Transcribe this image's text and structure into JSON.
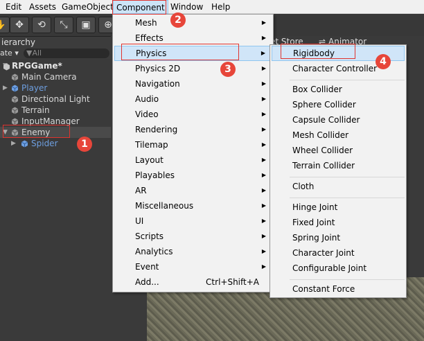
{
  "menubar": {
    "items": [
      "Edit",
      "Assets",
      "GameObject",
      "Component",
      "Window",
      "Help"
    ]
  },
  "toolbar": {
    "buttons": [
      "hand-icon",
      "move-icon",
      "rotate-icon",
      "scale-icon",
      "rect-icon",
      "transform-icon"
    ]
  },
  "hierarchy": {
    "tab_label": "ierarchy",
    "create_label": "ate ▾",
    "search_placeholder": "▼All",
    "scene_name": "RPGGame*",
    "items": [
      {
        "label": "Main Camera",
        "color": "#d8d8d8"
      },
      {
        "label": "Player",
        "color": "#6e9fe0"
      },
      {
        "label": "Directional Light",
        "color": "#d8d8d8"
      },
      {
        "label": "Terrain",
        "color": "#d8d8d8"
      },
      {
        "label": "InputManager",
        "color": "#d8d8d8"
      },
      {
        "label": "Enemy",
        "color": "#d8d8d8"
      },
      {
        "label": "Spider",
        "color": "#6e9fe0"
      }
    ]
  },
  "scene_tabs": {
    "asset_store": "et Store",
    "animator": "Animator"
  },
  "component_menu": {
    "items": [
      {
        "label": "Mesh",
        "submenu": true
      },
      {
        "label": "Effects",
        "submenu": true
      },
      {
        "label": "Physics",
        "submenu": true
      },
      {
        "label": "Physics 2D",
        "submenu": true
      },
      {
        "label": "Navigation",
        "submenu": true
      },
      {
        "label": "Audio",
        "submenu": true
      },
      {
        "label": "Video",
        "submenu": true
      },
      {
        "label": "Rendering",
        "submenu": true
      },
      {
        "label": "Tilemap",
        "submenu": true
      },
      {
        "label": "Layout",
        "submenu": true
      },
      {
        "label": "Playables",
        "submenu": true
      },
      {
        "label": "AR",
        "submenu": true
      },
      {
        "label": "Miscellaneous",
        "submenu": true
      },
      {
        "label": "UI",
        "submenu": true
      },
      {
        "label": "Scripts",
        "submenu": true
      },
      {
        "label": "Analytics",
        "submenu": true
      },
      {
        "label": "Event",
        "submenu": true
      },
      {
        "label": "Add...",
        "submenu": false,
        "shortcut": "Ctrl+Shift+A"
      }
    ]
  },
  "physics_menu": {
    "groups": [
      [
        "Rigidbody",
        "Character Controller"
      ],
      [
        "Box Collider",
        "Sphere Collider",
        "Capsule Collider",
        "Mesh Collider",
        "Wheel Collider",
        "Terrain Collider"
      ],
      [
        "Cloth"
      ],
      [
        "Hinge Joint",
        "Fixed Joint",
        "Spring Joint",
        "Character Joint",
        "Configurable Joint"
      ],
      [
        "Constant Force"
      ]
    ]
  },
  "annotations": {
    "badges": [
      "1",
      "2",
      "3",
      "4"
    ],
    "color": "#e0332e"
  }
}
